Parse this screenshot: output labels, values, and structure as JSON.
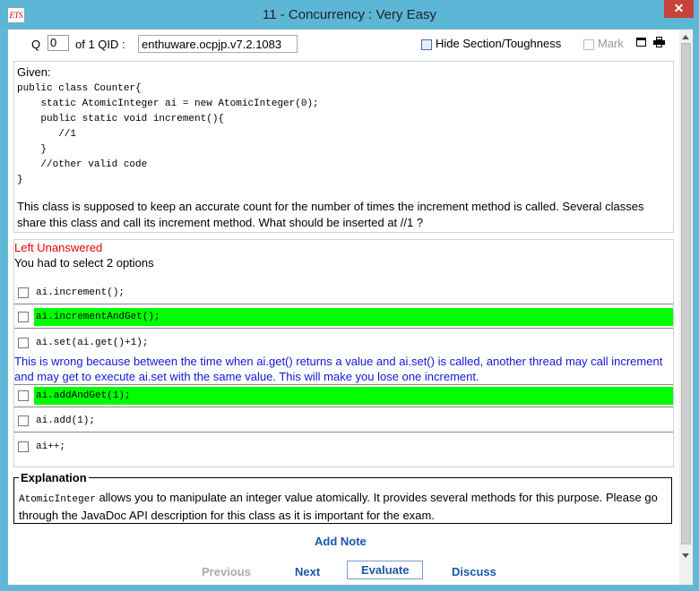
{
  "window": {
    "title": "11 - Concurrency  :  Very Easy",
    "app_icon": "ETS",
    "close_label": "✕"
  },
  "toolbar": {
    "q_label": "Q",
    "q_value": "0",
    "of_text": "of 1  QID :",
    "qid_value": "enthuware.ocpjp.v7.2.1083",
    "hide_section_label": "Hide Section/Toughness",
    "mark_label": "Mark"
  },
  "question": {
    "given": "Given:",
    "code": "public class Counter{\n    static AtomicInteger ai = new AtomicInteger(0);\n    public static void increment(){\n       //1\n    }\n    //other valid code\n}",
    "text": "This class is supposed to keep an accurate count for the number of times the increment method is called. Several classes share this class and call its increment method. What should be inserted at //1 ?"
  },
  "answers": {
    "status": "Left Unanswered",
    "instruction": "You had to select 2 options",
    "options": [
      {
        "text": "ai.increment();",
        "correct": false
      },
      {
        "text": "ai.incrementAndGet();",
        "correct": true
      },
      {
        "text": "ai.set(ai.get()+1);",
        "correct": false
      },
      {
        "text": "ai.addAndGet(1);",
        "correct": true
      },
      {
        "text": "ai.add(1);",
        "correct": false
      },
      {
        "text": "ai++;",
        "correct": false
      }
    ],
    "option3_explanation": "This is wrong because between the time when ai.get() returns a value and ai.set() is called, another thread may call increment and may get to execute ai.set with the same value. This will make you lose one increment."
  },
  "explanation": {
    "title": "Explanation",
    "code_term": "AtomicInteger",
    "text": " allows you to manipulate an integer value atomically. It provides several methods for this purpose. Please go through the JavaDoc API description for this class as it is important for the exam."
  },
  "actions": {
    "add_note": "Add Note",
    "previous": "Previous",
    "next": "Next",
    "evaluate": "Evaluate",
    "discuss": "Discuss"
  },
  "colors": {
    "correct_highlight": "#00ff00",
    "unanswered": "#e00000",
    "explanation_blue": "#1515d8",
    "link_blue": "#1a56a8"
  }
}
